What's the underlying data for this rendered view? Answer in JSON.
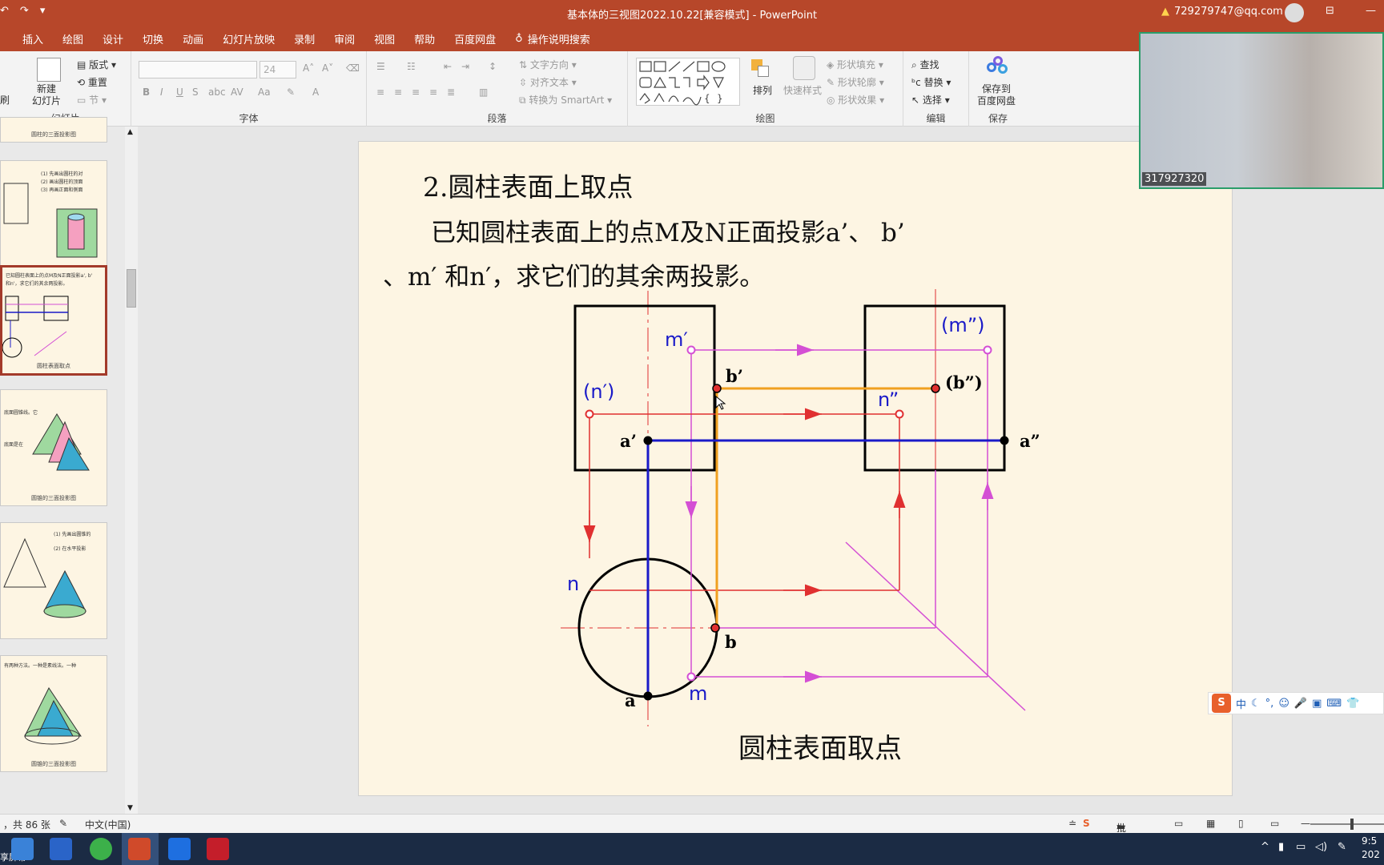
{
  "titlebar": {
    "title": "基本体的三视图2022.10.22[兼容模式]  -  PowerPoint",
    "account": "729279747@qq.com",
    "qat_icons": [
      "undo-icon",
      "redo-icon",
      "customize-icon"
    ]
  },
  "tabs": [
    "插入",
    "绘图",
    "设计",
    "切换",
    "动画",
    "幻灯片放映",
    "录制",
    "审阅",
    "视图",
    "帮助",
    "百度网盘",
    "操作说明搜索"
  ],
  "ribbon": {
    "slides_group": {
      "label": "幻灯片",
      "new_slide": "新建\n幻灯片",
      "layout": "版式",
      "reset": "重置",
      "section": "节",
      "left_cut": "刷"
    },
    "font_group": {
      "label": "字体",
      "font_name": "",
      "font_size": "24"
    },
    "paragraph_group": {
      "label": "段落",
      "text_direction": "文字方向",
      "align_text": "对齐文本",
      "convert_smartart": "转换为 SmartArt"
    },
    "drawing_group": {
      "label": "绘图",
      "arrange": "排列",
      "quick_styles": "快速样式",
      "shape_fill": "形状填充",
      "shape_outline": "形状轮廓",
      "shape_effects": "形状效果"
    },
    "editing_group": {
      "label": "编辑",
      "find": "查找",
      "replace": "替换",
      "select": "选择"
    },
    "save_group": {
      "label": "保存",
      "save_baidu": "保存到\n百度网盘"
    }
  },
  "thumbnails": [
    {
      "caption": "圆柱的三面投影图"
    },
    {
      "caption": ""
    },
    {
      "caption": "圆柱表面取点"
    },
    {
      "caption": "圆锥的三面投影图"
    },
    {
      "caption": ""
    },
    {
      "caption": "圆锥的三面投影图"
    }
  ],
  "slide": {
    "heading": "2.圆柱表面上取点",
    "line1": "已知圆柱表面上的点M及N正面投影a’、 b’",
    "line2": "、m′ 和n′，求它们的其余两投影。",
    "caption": "圆柱表面取点",
    "labels": {
      "m_prime": "m′",
      "n_prime": "(n′)",
      "b_prime": "b’",
      "a_prime": "a’",
      "m_dprime": "(m”)",
      "n_dprime": "n”",
      "b_dprime": "(b”)",
      "a_dprime": "a”",
      "n": "n",
      "b": "b",
      "a": "a",
      "m": "m"
    }
  },
  "webcam": {
    "label": "317927320"
  },
  "ime": {
    "logo": "S",
    "mode": "中"
  },
  "statusbar": {
    "slide_count": "，共 86 张",
    "language": "中文(中国)",
    "notes": "批注"
  },
  "taskbar": {
    "share_label": "享屏幕",
    "time": "9:5",
    "date": "202"
  },
  "colors": {
    "ppt_red": "#b7472a",
    "blue": "#1a1ac8",
    "magenta": "#d44fd4",
    "orange": "#f0a020",
    "red": "#e03030"
  }
}
